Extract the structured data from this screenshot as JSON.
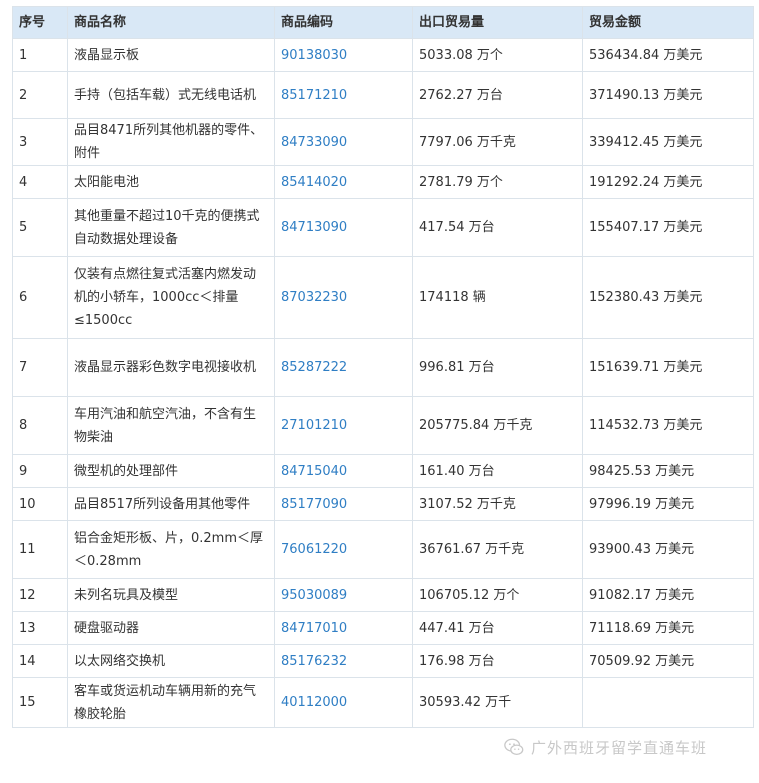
{
  "table": {
    "headers": [
      "序号",
      "商品名称",
      "商品编码",
      "出口贸易量",
      "贸易金额"
    ],
    "rows": [
      {
        "no": "1",
        "name": "液晶显示板",
        "code": "90138030",
        "volume": "5033.08 万个",
        "amount": "536434.84 万美元"
      },
      {
        "no": "2",
        "name": "手持（包括车载）式无线电话机",
        "code": "85171210",
        "volume": "2762.27 万台",
        "amount": "371490.13 万美元"
      },
      {
        "no": "3",
        "name": "品目8471所列其他机器的零件、附件",
        "code": "84733090",
        "volume": "7797.06 万千克",
        "amount": "339412.45 万美元"
      },
      {
        "no": "4",
        "name": "太阳能电池",
        "code": "85414020",
        "volume": "2781.79 万个",
        "amount": "191292.24 万美元"
      },
      {
        "no": "5",
        "name": "其他重量不超过10千克的便携式自动数据处理设备",
        "code": "84713090",
        "volume": "417.54 万台",
        "amount": "155407.17 万美元"
      },
      {
        "no": "6",
        "name": "仅装有点燃往复式活塞内燃发动机的小轿车，1000cc＜排量≤1500cc",
        "code": "87032230",
        "volume": "174118 辆",
        "amount": "152380.43 万美元"
      },
      {
        "no": "7",
        "name": "液晶显示器彩色数字电视接收机",
        "code": "85287222",
        "volume": "996.81 万台",
        "amount": "151639.71 万美元"
      },
      {
        "no": "8",
        "name": "车用汽油和航空汽油，不含有生物柴油",
        "code": "27101210",
        "volume": "205775.84 万千克",
        "amount": "114532.73 万美元"
      },
      {
        "no": "9",
        "name": "微型机的处理部件",
        "code": "84715040",
        "volume": "161.40 万台",
        "amount": "98425.53 万美元"
      },
      {
        "no": "10",
        "name": "品目8517所列设备用其他零件",
        "code": "85177090",
        "volume": "3107.52 万千克",
        "amount": "97996.19 万美元"
      },
      {
        "no": "11",
        "name": "铝合金矩形板、片，0.2mm＜厚＜0.28mm",
        "code": "76061220",
        "volume": "36761.67 万千克",
        "amount": "93900.43 万美元"
      },
      {
        "no": "12",
        "name": "未列名玩具及模型",
        "code": "95030089",
        "volume": "106705.12 万个",
        "amount": "91082.17 万美元"
      },
      {
        "no": "13",
        "name": "硬盘驱动器",
        "code": "84717010",
        "volume": "447.41 万台",
        "amount": "71118.69 万美元"
      },
      {
        "no": "14",
        "name": "以太网络交换机",
        "code": "85176232",
        "volume": "176.98 万台",
        "amount": "70509.92 万美元"
      },
      {
        "no": "15",
        "name": "客车或货运机动车辆用新的充气橡胶轮胎",
        "code": "40112000",
        "volume": "30593.42 万千",
        "amount": ""
      }
    ]
  },
  "watermark": {
    "text": "广外西班牙留学直通车班",
    "icon": "wechat-icon"
  },
  "colors": {
    "header_bg": "#d9e8f6",
    "link": "#2f7ec4",
    "border": "#dbe3ea",
    "text": "#333333"
  }
}
